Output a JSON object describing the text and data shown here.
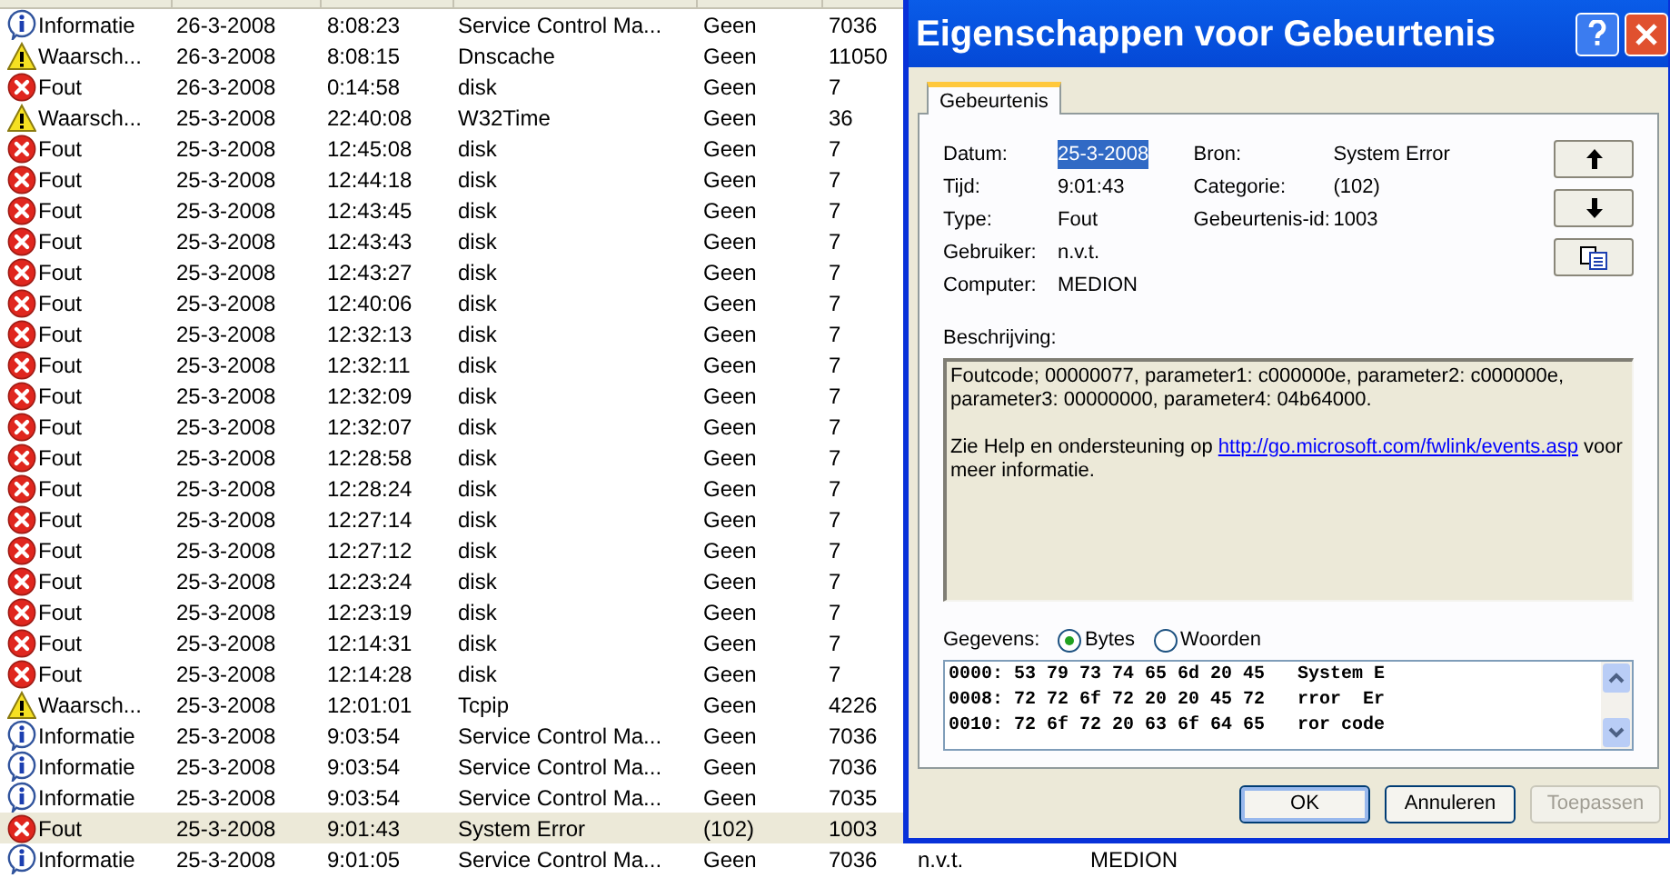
{
  "event_list": {
    "rows": [
      {
        "kind": "info",
        "type": "Informatie",
        "date": "26-3-2008",
        "time": "8:08:23",
        "source": "Service Control Ma...",
        "category": "Geen",
        "event": "7036",
        "selected": false
      },
      {
        "kind": "warning",
        "type": "Waarsch...",
        "date": "26-3-2008",
        "time": "8:08:15",
        "source": "Dnscache",
        "category": "Geen",
        "event": "11050",
        "selected": false
      },
      {
        "kind": "error",
        "type": "Fout",
        "date": "26-3-2008",
        "time": "0:14:58",
        "source": "disk",
        "category": "Geen",
        "event": "7",
        "selected": false
      },
      {
        "kind": "warning",
        "type": "Waarsch...",
        "date": "25-3-2008",
        "time": "22:40:08",
        "source": "W32Time",
        "category": "Geen",
        "event": "36",
        "selected": false
      },
      {
        "kind": "error",
        "type": "Fout",
        "date": "25-3-2008",
        "time": "12:45:08",
        "source": "disk",
        "category": "Geen",
        "event": "7",
        "selected": false
      },
      {
        "kind": "error",
        "type": "Fout",
        "date": "25-3-2008",
        "time": "12:44:18",
        "source": "disk",
        "category": "Geen",
        "event": "7",
        "selected": false
      },
      {
        "kind": "error",
        "type": "Fout",
        "date": "25-3-2008",
        "time": "12:43:45",
        "source": "disk",
        "category": "Geen",
        "event": "7",
        "selected": false
      },
      {
        "kind": "error",
        "type": "Fout",
        "date": "25-3-2008",
        "time": "12:43:43",
        "source": "disk",
        "category": "Geen",
        "event": "7",
        "selected": false
      },
      {
        "kind": "error",
        "type": "Fout",
        "date": "25-3-2008",
        "time": "12:43:27",
        "source": "disk",
        "category": "Geen",
        "event": "7",
        "selected": false
      },
      {
        "kind": "error",
        "type": "Fout",
        "date": "25-3-2008",
        "time": "12:40:06",
        "source": "disk",
        "category": "Geen",
        "event": "7",
        "selected": false
      },
      {
        "kind": "error",
        "type": "Fout",
        "date": "25-3-2008",
        "time": "12:32:13",
        "source": "disk",
        "category": "Geen",
        "event": "7",
        "selected": false
      },
      {
        "kind": "error",
        "type": "Fout",
        "date": "25-3-2008",
        "time": "12:32:11",
        "source": "disk",
        "category": "Geen",
        "event": "7",
        "selected": false
      },
      {
        "kind": "error",
        "type": "Fout",
        "date": "25-3-2008",
        "time": "12:32:09",
        "source": "disk",
        "category": "Geen",
        "event": "7",
        "selected": false
      },
      {
        "kind": "error",
        "type": "Fout",
        "date": "25-3-2008",
        "time": "12:32:07",
        "source": "disk",
        "category": "Geen",
        "event": "7",
        "selected": false
      },
      {
        "kind": "error",
        "type": "Fout",
        "date": "25-3-2008",
        "time": "12:28:58",
        "source": "disk",
        "category": "Geen",
        "event": "7",
        "selected": false
      },
      {
        "kind": "error",
        "type": "Fout",
        "date": "25-3-2008",
        "time": "12:28:24",
        "source": "disk",
        "category": "Geen",
        "event": "7",
        "selected": false
      },
      {
        "kind": "error",
        "type": "Fout",
        "date": "25-3-2008",
        "time": "12:27:14",
        "source": "disk",
        "category": "Geen",
        "event": "7",
        "selected": false
      },
      {
        "kind": "error",
        "type": "Fout",
        "date": "25-3-2008",
        "time": "12:27:12",
        "source": "disk",
        "category": "Geen",
        "event": "7",
        "selected": false
      },
      {
        "kind": "error",
        "type": "Fout",
        "date": "25-3-2008",
        "time": "12:23:24",
        "source": "disk",
        "category": "Geen",
        "event": "7",
        "selected": false
      },
      {
        "kind": "error",
        "type": "Fout",
        "date": "25-3-2008",
        "time": "12:23:19",
        "source": "disk",
        "category": "Geen",
        "event": "7",
        "selected": false
      },
      {
        "kind": "error",
        "type": "Fout",
        "date": "25-3-2008",
        "time": "12:14:31",
        "source": "disk",
        "category": "Geen",
        "event": "7",
        "selected": false
      },
      {
        "kind": "error",
        "type": "Fout",
        "date": "25-3-2008",
        "time": "12:14:28",
        "source": "disk",
        "category": "Geen",
        "event": "7",
        "selected": false
      },
      {
        "kind": "warning",
        "type": "Waarsch...",
        "date": "25-3-2008",
        "time": "12:01:01",
        "source": "Tcpip",
        "category": "Geen",
        "event": "4226",
        "selected": false
      },
      {
        "kind": "info",
        "type": "Informatie",
        "date": "25-3-2008",
        "time": "9:03:54",
        "source": "Service Control Ma...",
        "category": "Geen",
        "event": "7036",
        "selected": false
      },
      {
        "kind": "info",
        "type": "Informatie",
        "date": "25-3-2008",
        "time": "9:03:54",
        "source": "Service Control Ma...",
        "category": "Geen",
        "event": "7036",
        "selected": false
      },
      {
        "kind": "info",
        "type": "Informatie",
        "date": "25-3-2008",
        "time": "9:03:54",
        "source": "Service Control Ma...",
        "category": "Geen",
        "event": "7035",
        "selected": false
      },
      {
        "kind": "error",
        "type": "Fout",
        "date": "25-3-2008",
        "time": "9:01:43",
        "source": "System Error",
        "category": "(102)",
        "event": "1003",
        "selected": true
      },
      {
        "kind": "info",
        "type": "Informatie",
        "date": "25-3-2008",
        "time": "9:01:05",
        "source": "Service Control Ma...",
        "category": "Geen",
        "event": "7036",
        "user": "n.v.t.",
        "computer": "MEDION",
        "selected": false
      }
    ]
  },
  "dialog": {
    "title": "Eigenschappen voor Gebeurtenis",
    "tabs": [
      {
        "label": "Gebeurtenis",
        "selected": true
      }
    ],
    "fields_left": [
      {
        "label": "Datum:",
        "value": "25-3-2008",
        "highlighted": true
      },
      {
        "label": "Tijd:",
        "value": "9:01:43",
        "highlighted": false
      },
      {
        "label": "Type:",
        "value": "Fout",
        "highlighted": false
      },
      {
        "label": "Gebruiker:",
        "value": "n.v.t.",
        "highlighted": false
      },
      {
        "label": "Computer:",
        "value": "MEDION",
        "highlighted": false
      }
    ],
    "fields_right": [
      {
        "label": "Bron:",
        "value": "System Error"
      },
      {
        "label": "Categorie:",
        "value": "(102)"
      },
      {
        "label": "Gebeurtenis-id:",
        "value": "1003"
      }
    ],
    "description_label": "Beschrijving:",
    "description": {
      "paragraph_1": "Foutcode; 00000077, parameter1: c000000e, parameter2: c000000e, parameter3: 00000000, parameter4: 04b64000.",
      "paragraph_2_before": "Zie Help en ondersteuning op",
      "link": "http://go.microsoft.com/fwlink/events.asp",
      "paragraph_2_after": "voor meer informatie."
    },
    "data_label": "Gegevens:",
    "data_formats": [
      {
        "label": "Bytes",
        "selected": true
      },
      {
        "label": "Woorden",
        "selected": false
      }
    ],
    "data_lines": [
      "0000: 53 79 73 74 65 6d 20 45   System E",
      "0008: 72 72 6f 72 20 20 45 72   rror  Er",
      "0010: 72 6f 72 20 63 6f 64 65   ror code"
    ],
    "buttons": [
      {
        "label": "OK",
        "disabled": false,
        "default": true
      },
      {
        "label": "Annuleren",
        "disabled": false,
        "default": false
      },
      {
        "label": "Toepassen",
        "disabled": true,
        "default": false
      }
    ]
  }
}
